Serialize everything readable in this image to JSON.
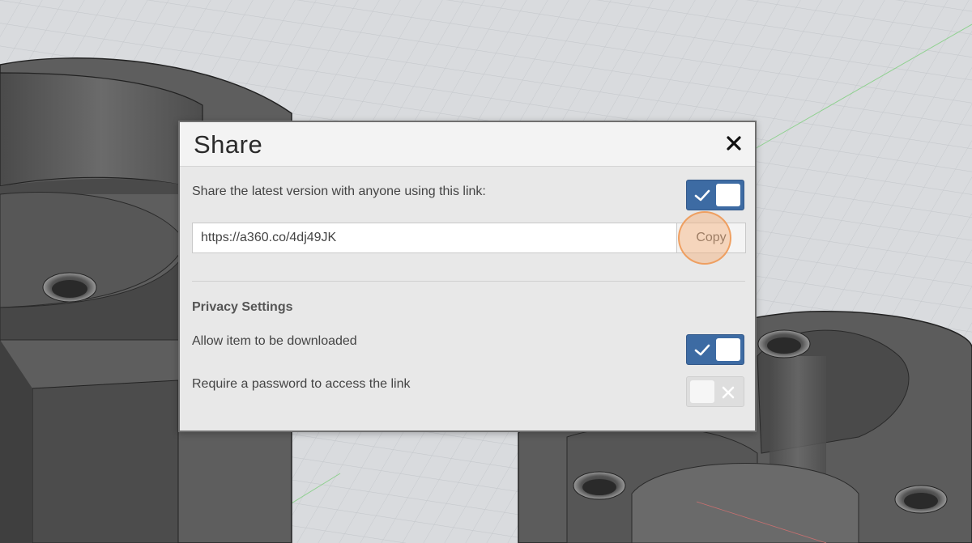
{
  "dialog": {
    "title": "Share",
    "share_label": "Share the latest version with anyone using this link:",
    "share_enabled": true,
    "link_value": "https://a360.co/4dj49JK",
    "copy_label": "Copy",
    "privacy_title": "Privacy Settings",
    "download_label": "Allow item to be downloaded",
    "download_enabled": true,
    "password_label": "Require a password to access the link",
    "password_enabled": false
  },
  "colors": {
    "toggle_on": "#3d6ba3",
    "toggle_off": "#dedede",
    "click_highlight": "#f0a060",
    "model_surface": "#5a5a5a",
    "grid_background": "#d7d9dc"
  },
  "icons": {
    "close": "close-icon",
    "check": "checkmark-icon",
    "off": "x-icon"
  }
}
